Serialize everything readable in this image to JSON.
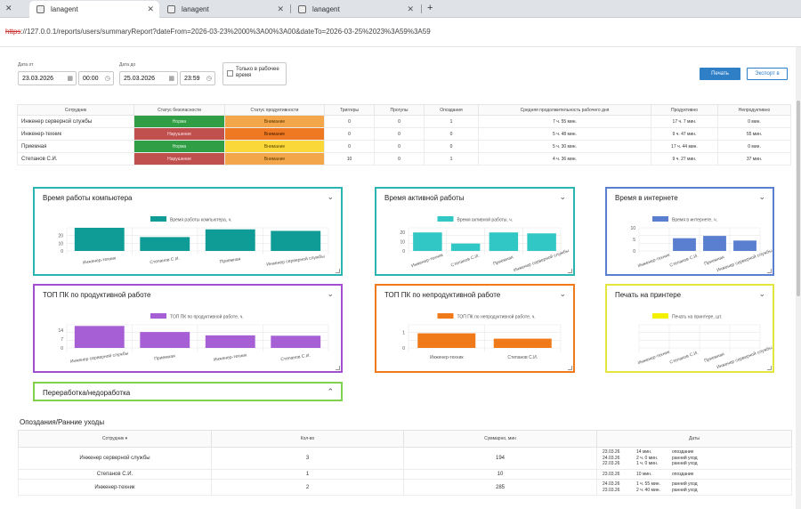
{
  "browser": {
    "tabs": [
      {
        "label": "lanagent",
        "active": true
      },
      {
        "label": "lanagent",
        "active": false
      },
      {
        "label": "lanagent",
        "active": false
      }
    ],
    "close_glyph": "✕",
    "new_tab_glyph": "+",
    "url_proto": "https",
    "url_rest": "://127.0.0.1/reports/users/summaryReport?dateFrom=2026-03-23%2000%3A00%3A00&dateTo=2026-03-25%2023%3A59%3A59"
  },
  "filters": {
    "date_from_label": "Дата от",
    "date_from": "23.03.2026",
    "time_from": "00:00",
    "date_to_label": "Дата до",
    "date_to": "25.03.2026",
    "time_to": "23:59",
    "work_time_only": "Только в рабочее время",
    "print_button": "Печать",
    "export_button": "Экспорт в"
  },
  "summary": {
    "headers": [
      "Сотрудник",
      "Статус безопасности",
      "Статус продуктивности",
      "Триггеры",
      "Прогулы",
      "Опоздания",
      "Средняя продолжительность рабочего дня",
      "Продуктивно",
      "Непродуктивно"
    ],
    "rows": [
      {
        "name": "Инженер серверной службы",
        "sec": "Норма",
        "sec_cls": "norm",
        "prod": "Внимание",
        "prod_cls": "warn",
        "triggers": "0",
        "absences": "0",
        "late": "1",
        "avg": "7 ч. 55 мин.",
        "productive": "17 ч. 7 мин.",
        "unproductive": "0 мин."
      },
      {
        "name": "Инженер-техник",
        "sec": "Нарушение",
        "sec_cls": "bad",
        "prod": "Внимание",
        "prod_cls": "crit",
        "triggers": "0",
        "absences": "0",
        "late": "0",
        "avg": "5 ч. 48 мин.",
        "productive": "9 ч. 47 мин.",
        "unproductive": "55 мин."
      },
      {
        "name": "Приемная",
        "sec": "Норма",
        "sec_cls": "norm",
        "prod": "Внимание",
        "prod_cls": "warn2",
        "triggers": "0",
        "absences": "0",
        "late": "0",
        "avg": "5 ч. 30 мин.",
        "productive": "17 ч. 44 мин.",
        "unproductive": "0 мин."
      },
      {
        "name": "Степанов С.И.",
        "sec": "Нарушение",
        "sec_cls": "bad",
        "prod": "Внимание",
        "prod_cls": "warn",
        "triggers": "10",
        "absences": "0",
        "late": "1",
        "avg": "4 ч. 36 мин.",
        "productive": "9 ч. 27 мин.",
        "unproductive": "37 мин."
      }
    ]
  },
  "panels": [
    {
      "title": "Время работы компьютера",
      "color": "#2bb5b0",
      "chevron": "⌄"
    },
    {
      "title": "Время активной работы",
      "color": "#2bb5b0",
      "chevron": "⌄"
    },
    {
      "title": "Время в интернете",
      "color": "#5b7fd0",
      "chevron": "⌄"
    },
    {
      "title": "ТОП ПК по продуктивной работе",
      "color": "#a14fd0",
      "chevron": "⌄"
    },
    {
      "title": "ТОП ПК по непродуктивной работе",
      "color": "#f07a1a",
      "chevron": "⌄"
    },
    {
      "title": "Печать на принтере",
      "color": "#e4e640",
      "chevron": "⌄"
    },
    {
      "title": "Переработка/недоработка",
      "color": "#7ed34a",
      "chevron": "⌃"
    }
  ],
  "chart_data": [
    {
      "type": "bar",
      "title": "Время работы компьютера",
      "series": [
        {
          "name": "Время работы компьютера, ч.",
          "values": [
            30,
            18,
            28,
            26
          ]
        }
      ],
      "categories": [
        "Инженер-техник",
        "Степанов С.И.",
        "Приемная",
        "Инженер серверной службы"
      ],
      "y_ticks": [
        "20",
        "10",
        "0"
      ],
      "ylim": [
        0,
        30
      ],
      "color": "#0f9b96"
    },
    {
      "type": "bar",
      "title": "Время активной работы",
      "series": [
        {
          "name": "Время активной работы, ч.",
          "values": [
            20,
            8,
            20,
            19
          ]
        }
      ],
      "categories": [
        "Инженер-техник",
        "Степанов С.И.",
        "Приемная",
        "Инженер серверной службы"
      ],
      "y_ticks": [
        "20",
        "10",
        "0"
      ],
      "ylim": [
        0,
        25
      ],
      "color": "#31c7c4"
    },
    {
      "type": "bar",
      "title": "Время в интернете",
      "series": [
        {
          "name": "Время в интернете, ч.",
          "values": [
            0,
            5.5,
            6.5,
            4.5
          ]
        }
      ],
      "categories": [
        "Инженер-техник",
        "Степанов С.И.",
        "Приемная",
        "Инженер серверной службы"
      ],
      "y_ticks": [
        "10",
        "5",
        "0"
      ],
      "ylim": [
        0,
        10
      ],
      "color": "#5b7fd0"
    },
    {
      "type": "bar",
      "title": "ТОП ПК по продуктивной работе",
      "series": [
        {
          "name": "ТОП ПК по продуктивной работе, ч.",
          "values": [
            17.1,
            12.4,
            9.8,
            9.5
          ]
        }
      ],
      "categories": [
        "Инженер серверной службы",
        "Приемная",
        "Инженер-техник",
        "Степанов С.И."
      ],
      "y_ticks": [
        "14",
        "7",
        "0"
      ],
      "ylim": [
        0,
        18
      ],
      "color": "#a75fd6"
    },
    {
      "type": "bar",
      "title": "ТОП ПК по непродуктивной работе",
      "series": [
        {
          "name": "ТОП ПК по непродуктивной работе, ч.",
          "values": [
            0.95,
            0.6
          ]
        }
      ],
      "categories": [
        "Инженер-техник",
        "Степанов С.И."
      ],
      "y_ticks": [
        "1",
        "0"
      ],
      "ylim": [
        0,
        1.5
      ],
      "color": "#f07a1a"
    },
    {
      "type": "bar",
      "title": "Печать на принтере",
      "series": [
        {
          "name": "Печать на принтере, шт.",
          "values": [
            0,
            0,
            0,
            0
          ]
        }
      ],
      "categories": [
        "Инженер-техник",
        "Степанов С.И.",
        "Приемная",
        "Инженер серверной службы"
      ],
      "y_ticks": [],
      "ylim": [
        0,
        1
      ],
      "color": "#f3f000"
    }
  ],
  "late_section": {
    "title": "Опоздания/Ранние уходы",
    "headers": [
      "Сотрудник",
      "Кол-во",
      "Суммарно, мин",
      "Даты"
    ],
    "sort_glyph": "▾",
    "rows": [
      {
        "name": "Инженер серверной службы",
        "count": "3",
        "total": "194",
        "dates": [
          {
            "d": "23.03.26",
            "t": "14 мин.",
            "k": "опоздание"
          },
          {
            "d": "24.03.26",
            "t": "2 ч. 0 мин.",
            "k": "ранний уход"
          },
          {
            "d": "22.03.26",
            "t": "1 ч. 0 мин.",
            "k": "ранний уход"
          }
        ]
      },
      {
        "name": "Степанов С.И.",
        "count": "1",
        "total": "10",
        "dates": [
          {
            "d": "23.03.26",
            "t": "10 мин.",
            "k": "опоздание"
          }
        ]
      },
      {
        "name": "Инженер-техник",
        "count": "2",
        "total": "285",
        "dates": [
          {
            "d": "24.03.26",
            "t": "1 ч. 55 мин.",
            "k": "ранний уход"
          },
          {
            "d": "23.03.26",
            "t": "2 ч. 40 мин.",
            "k": "ранний уход"
          }
        ]
      }
    ]
  }
}
